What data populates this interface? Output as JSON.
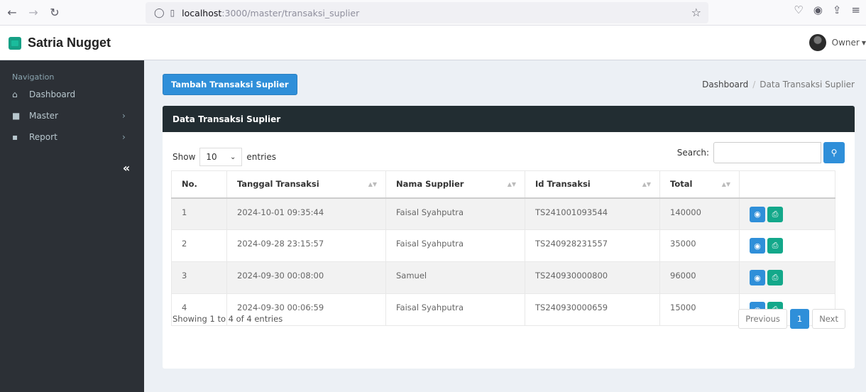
{
  "browser": {
    "url_host": "localhost",
    "url_path": ":3000/master/transaksi_suplier"
  },
  "header": {
    "brand": "Satria Nugget",
    "user": "Owner"
  },
  "sidebar": {
    "heading": "Navigation",
    "items": [
      {
        "label": "Dashboard",
        "icon": "home-icon"
      },
      {
        "label": "Master",
        "icon": "folder-icon"
      },
      {
        "label": "Report",
        "icon": "file-icon"
      }
    ],
    "collapse_label": "«"
  },
  "toolbar": {
    "add_label": "Tambah Transaksi Suplier"
  },
  "breadcrumb": {
    "home": "Dashboard",
    "current": "Data Transaksi Suplier"
  },
  "box": {
    "title": "Data Transaksi Suplier",
    "show_label": "Show",
    "length_value": "10",
    "entries_label": "entries",
    "search_label": "Search:"
  },
  "table": {
    "columns": [
      "No.",
      "Tanggal Transaksi",
      "Nama Supplier",
      "Id Transaksi",
      "Total",
      ""
    ],
    "rows": [
      {
        "no": "1",
        "tanggal": "2024-10-01 09:35:44",
        "nama": "Faisal Syahputra",
        "id": "TS241001093544",
        "total": "140000"
      },
      {
        "no": "2",
        "tanggal": "2024-09-28 23:15:57",
        "nama": "Faisal Syahputra",
        "id": "TS240928231557",
        "total": "35000"
      },
      {
        "no": "3",
        "tanggal": "2024-09-30 00:08:00",
        "nama": "Samuel",
        "id": "TS240930000800",
        "total": "96000"
      },
      {
        "no": "4",
        "tanggal": "2024-09-30 00:06:59",
        "nama": "Faisal Syahputra",
        "id": "TS240930000659",
        "total": "15000"
      }
    ]
  },
  "footer": {
    "info": "Showing 1 to 4 of 4 entries",
    "previous": "Previous",
    "current_page": "1",
    "next": "Next"
  },
  "colors": {
    "primary": "#2f8fd9",
    "success": "#13a88a",
    "sidebar": "#2c3036",
    "box_header": "#222d32"
  }
}
